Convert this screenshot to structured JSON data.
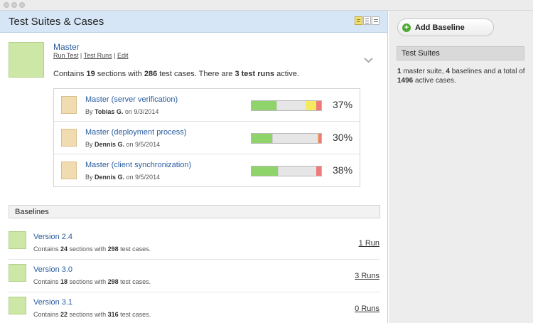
{
  "header": {
    "title": "Test Suites & Cases"
  },
  "master": {
    "title": "Master",
    "actions": {
      "run_test": "Run Test",
      "sep1": "|",
      "test_runs": "Test Runs",
      "sep2": "|",
      "edit": "Edit"
    },
    "desc": {
      "p1": "Contains ",
      "sections": "19",
      "p2": " sections with ",
      "cases": "286",
      "p3": " test cases. There are ",
      "runs": "3 test runs",
      "p4": " active."
    }
  },
  "runs": [
    {
      "title": "Master (server verification)",
      "by": "By ",
      "author": "Tobias G.",
      "date": " on 9/3/2014",
      "percent": "37%",
      "bar": {
        "passed": 0.36,
        "untested": 0.42,
        "retest": 0.15,
        "failed": 0.07
      }
    },
    {
      "title": "Master (deployment process)",
      "by": "By ",
      "author": "Dennis G.",
      "date": " on 9/5/2014",
      "percent": "30%",
      "bar": {
        "passed": 0.3,
        "untested": 0.64,
        "retest": 0.02,
        "failed": 0.04
      }
    },
    {
      "title": "Master (client synchronization)",
      "by": "By ",
      "author": "Dennis G.",
      "date": " on 9/5/2014",
      "percent": "38%",
      "bar": {
        "passed": 0.38,
        "untested": 0.55,
        "retest": 0.0,
        "failed": 0.07
      }
    }
  ],
  "baselines": {
    "header": "Baselines",
    "items": [
      {
        "title": "Version 2.4",
        "p1": "Contains ",
        "sections": "24",
        "p2": " sections with ",
        "cases": "298",
        "p3": " test cases.",
        "runs": "1 Run"
      },
      {
        "title": "Version 3.0",
        "p1": "Contains ",
        "sections": "18",
        "p2": " sections with ",
        "cases": "298",
        "p3": " test cases.",
        "runs": "3 Runs"
      },
      {
        "title": "Version 3.1",
        "p1": "Contains ",
        "sections": "22",
        "p2": " sections with ",
        "cases": "316",
        "p3": " test cases.",
        "runs": "0 Runs"
      }
    ]
  },
  "sidebar": {
    "add_baseline": "Add Baseline",
    "section_title": "Test Suites",
    "summary": {
      "n_master": "1",
      "t1": " master suite, ",
      "n_baselines": "4",
      "t2": " baselines and a total of ",
      "n_cases": "1496",
      "t3": " active cases."
    }
  },
  "colors": {
    "passed": "#8fd46a",
    "untested": "#e6e6e6",
    "retest": "#f3ea60",
    "failed": "#ee7a7a",
    "header_bg": "#d6e6f7",
    "link": "#2a5d9f"
  }
}
